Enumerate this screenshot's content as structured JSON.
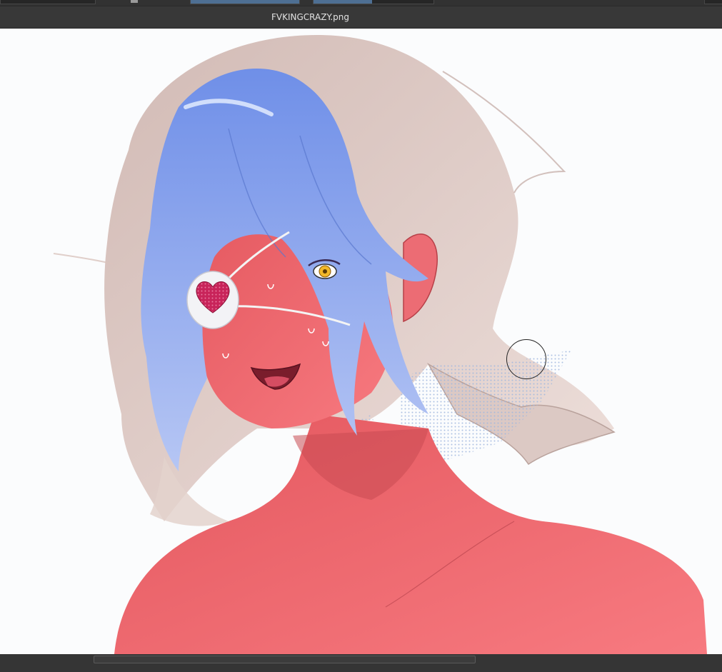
{
  "document": {
    "tab_title": "FVKINGCRAZY.png"
  },
  "artwork": {
    "icon": "heart-eyepatch-icon",
    "colors": {
      "skin": "#ef6a72",
      "hair_blue": "#8aa6f0",
      "hair_beige": "#d9c3bd",
      "eyepatch_heart": "#c8245a",
      "eye": "#f2b82a",
      "background": "#fbfcfd"
    }
  },
  "ui_colors": {
    "toolbar": "#323232",
    "tab": "#383838",
    "accent": "#4e6f93"
  }
}
